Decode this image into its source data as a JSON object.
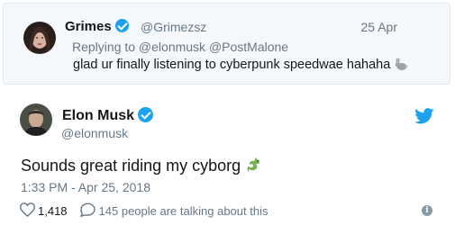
{
  "reply_tweet": {
    "author_name": "Grimes",
    "author_handle": "@Grimezsz",
    "date": "25 Apr",
    "replying_to": "Replying to @elonmusk @PostMalone",
    "text": "glad ur finally listening to cyberpunk speedwae hahaha",
    "emoji_icon": "rabbit-icon"
  },
  "main_tweet": {
    "author_name": "Elon Musk",
    "author_handle": "@elonmusk",
    "text": "Sounds great riding my cyborg",
    "emoji_icon": "dragon-icon",
    "timestamp": "1:33 PM - Apr 25, 2018",
    "like_count": "1,418",
    "talking_about": "145 people are talking about this"
  },
  "colors": {
    "twitter_blue": "#1da1f2",
    "secondary_text": "#657786",
    "border": "#e1e8ed",
    "reply_background": "#f5f8fa"
  }
}
